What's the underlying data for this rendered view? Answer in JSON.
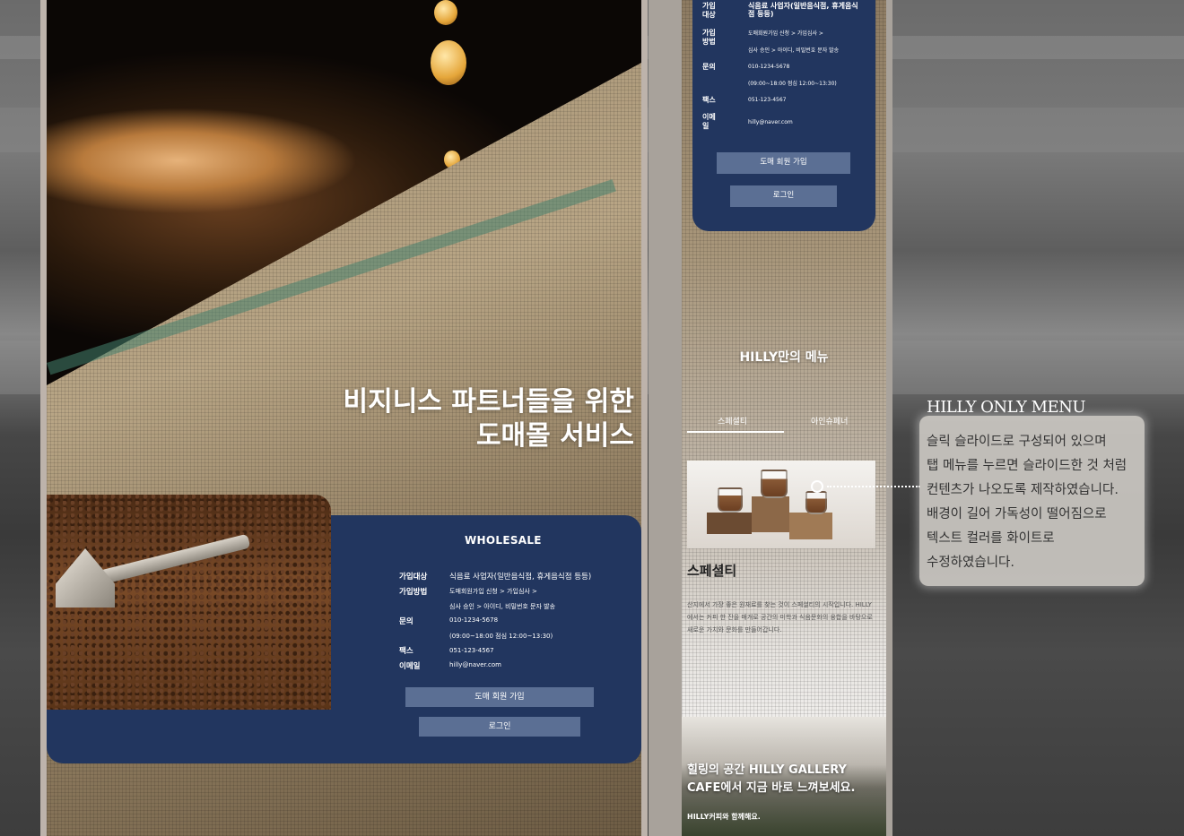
{
  "left_panel": {
    "hero_line1": "비지니스 파트너들을 위한",
    "hero_line2": "도매몰 서비스",
    "card_title": "WHOLESALE",
    "rows": [
      {
        "label": "가입대상",
        "value": "식음료 사업자(일반음식점, 휴게음식점 등등)"
      },
      {
        "label": "가입방법",
        "value": "도매회원가입 신청 > 가입심사 >"
      },
      {
        "label": "",
        "value": "심사 승인 > 아이디, 비밀번호 문자 발송"
      },
      {
        "label": "문의",
        "value": "010-1234-5678"
      },
      {
        "label": "",
        "value": "(09:00~18:00 점심 12:00~13:30)"
      },
      {
        "label": "팩스",
        "value": "051-123-4567"
      },
      {
        "label": "이메일",
        "value": "hilly@naver.com"
      }
    ],
    "join_button": "도매 회원 가입",
    "login_button": "로그인"
  },
  "mobile_panel": {
    "rows": [
      {
        "label": "가입 대상",
        "value": "식음료 사업자(일반음식점, 휴게음식점 등등)"
      },
      {
        "label": "가입 방법",
        "value": "도매회원가입 신청 > 가입심사 >"
      },
      {
        "label": "",
        "value": "심사 승인 > 아이디, 비밀번호 문자 발송"
      },
      {
        "label": "문의",
        "value": "010-1234-5678"
      },
      {
        "label": "",
        "value": "(09:00~18:00 점심 12:00~13:30)"
      },
      {
        "label": "팩스",
        "value": "051-123-4567"
      },
      {
        "label": "이메 일",
        "value": "hilly@naver.com"
      }
    ],
    "join_button": "도매 회원 가입",
    "login_button": "로그인",
    "menu_section_title": "HILLY만의 메뉴",
    "tabs": [
      "스페셜티",
      "아인슈페너"
    ],
    "slide_heading": "스페셜티",
    "slide_body": "산지에서 가장 좋은 원재료를 찾는 것이 스페셜티의 시작입니다. HILLY에서는 커피 한 잔을 매개로 공간의 미학과 식음문화의 융합을 바탕으로 새로운 가치와 문화를 만들어갑니다.",
    "gallery_title_line1": "힐링의 공간 HILLY GALLERY",
    "gallery_title_line2": "CAFE에서 지금 바로 느껴보세요.",
    "gallery_sub": "HILLY커피와 함께해요."
  },
  "annotation": {
    "title": "HILLY ONLY MENU",
    "lines": [
      "슬릭 슬라이드로 구성되어 있으며",
      "탭 메뉴를 누르면 슬라이드한 것 처럼",
      "컨텐츠가 나오도록 제작하였습니다.",
      "배경이 길어 가독성이 떨어짐으로",
      "텍스트 컬러를 화이트로",
      "수정하였습니다."
    ]
  },
  "colors": {
    "navy": "#22365f",
    "button": "#5b6f94",
    "frame": "#bdb3ab"
  }
}
